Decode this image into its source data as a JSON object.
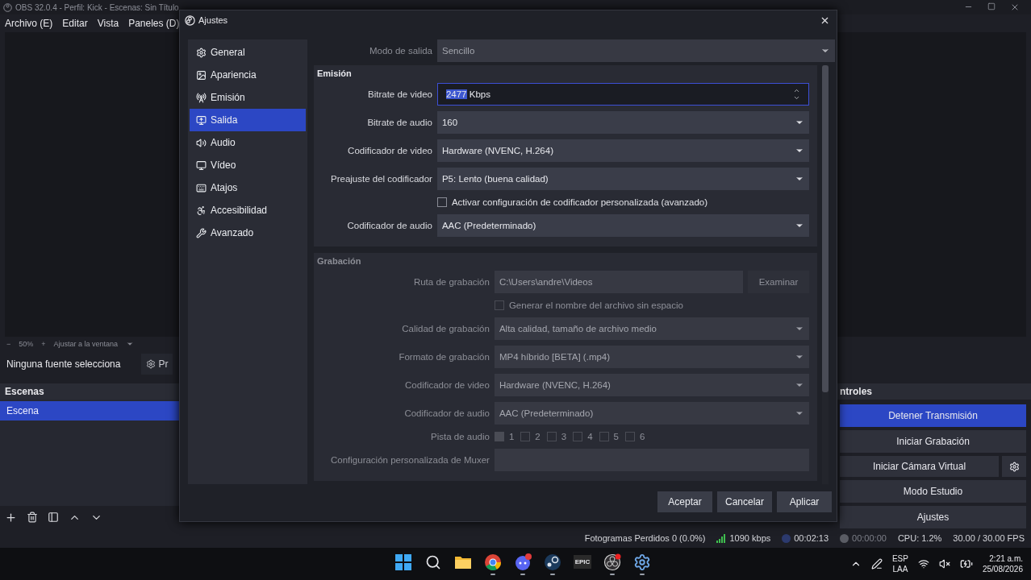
{
  "main_window": {
    "title": "OBS 32.0.4 - Perfil: Kick - Escenas: Sin Título",
    "menu": [
      "Archivo (E)",
      "Editar",
      "Vista",
      "Paneles (D)"
    ]
  },
  "zoom_bar": {
    "minus": "−",
    "zoom": "50%",
    "plus": "+",
    "fit": "Ajustar a la ventana"
  },
  "source_bar": {
    "label": "Ninguna fuente selecciona",
    "button": "Pr"
  },
  "scenes_dock": {
    "title": "Escenas",
    "scenes": [
      {
        "name": "Escena",
        "selected": true
      }
    ]
  },
  "controls_dock": {
    "title": "ntroles",
    "buttons": [
      {
        "label": "Detener Transmisión",
        "on": true,
        "kind": "plain"
      },
      {
        "label": "Iniciar Grabación",
        "on": false,
        "kind": "plain"
      },
      {
        "label": "Iniciar Cámara Virtual",
        "on": false,
        "kind": "split"
      },
      {
        "label": "Modo Estudio",
        "on": false,
        "kind": "plain"
      },
      {
        "label": "Ajustes",
        "on": false,
        "kind": "plain"
      }
    ]
  },
  "status_bar": {
    "dropped": "Fotogramas Perdidos 0 (0.0%)",
    "bitrate": "1090 kbps",
    "stream_time": "00:02:13",
    "streaming": true,
    "record_time": "00:00:00",
    "recording": false,
    "cpu": "CPU: 1.2%",
    "fps": "30.00 / 30.00 FPS"
  },
  "dialog": {
    "title": "Ajustes",
    "sidebar": [
      {
        "label": "General",
        "kind": "gear",
        "selected": false
      },
      {
        "label": "Apariencia",
        "kind": "image",
        "selected": false
      },
      {
        "label": "Emisión",
        "kind": "antenna",
        "selected": false
      },
      {
        "label": "Salida",
        "kind": "output",
        "selected": true
      },
      {
        "label": "Audio",
        "kind": "speaker",
        "selected": false
      },
      {
        "label": "Vídeo",
        "kind": "monitor",
        "selected": false
      },
      {
        "label": "Atajos",
        "kind": "keyboard",
        "selected": false
      },
      {
        "label": "Accesibilidad",
        "kind": "figure",
        "selected": false
      },
      {
        "label": "Avanzado",
        "kind": "tools",
        "selected": false
      }
    ],
    "output_mode": {
      "label": "Modo de salida",
      "value": "Sencillo"
    },
    "groups": [
      {
        "title": "Emisión",
        "disabled": false,
        "rows": [
          {
            "kind": "spin",
            "label": "Bitrate de video",
            "value": "2477",
            "unit": "Kbps",
            "focused": true
          },
          {
            "kind": "select",
            "label": "Bitrate de audio",
            "value": "160"
          },
          {
            "kind": "select",
            "label": "Codificador de video",
            "value": "Hardware (NVENC, H.264)"
          },
          {
            "kind": "select",
            "label": "Preajuste del codificador",
            "value": "P5: Lento (buena calidad)"
          },
          {
            "kind": "checkbox",
            "label": "Activar configuración de codificador personalizada (avanzado)",
            "checked": false
          },
          {
            "kind": "select",
            "label": "Codificador de audio",
            "value": "AAC (Predeterminado)"
          }
        ]
      },
      {
        "title": "Grabación",
        "disabled": true,
        "rows": [
          {
            "kind": "path",
            "label": "Ruta de grabación",
            "value": "C:\\Users\\andre\\Videos",
            "button": "Examinar"
          },
          {
            "kind": "checkbox",
            "label": "Generar el nombre del archivo sin espacio",
            "checked": false
          },
          {
            "kind": "select",
            "label": "Calidad de grabación",
            "value": "Alta calidad, tamaño de archivo medio"
          },
          {
            "kind": "select",
            "label": "Formato de grabación",
            "value": "MP4 híbrido [BETA] (.mp4)"
          },
          {
            "kind": "select",
            "label": "Codificador de video",
            "value": "Hardware (NVENC, H.264)"
          },
          {
            "kind": "select",
            "label": "Codificador de audio",
            "value": "AAC (Predeterminado)"
          },
          {
            "kind": "tracks",
            "label": "Pista de audio",
            "tracks": [
              {
                "label": "1",
                "checked": true
              },
              {
                "label": "2",
                "checked": false
              },
              {
                "label": "3",
                "checked": false
              },
              {
                "label": "4",
                "checked": false
              },
              {
                "label": "5",
                "checked": false
              },
              {
                "label": "6",
                "checked": false
              }
            ]
          },
          {
            "kind": "text",
            "label": "Configuración personalizada de Muxer"
          }
        ]
      }
    ],
    "buttons": [
      "Aceptar",
      "Cancelar",
      "Aplicar"
    ]
  },
  "taskbar": {
    "apps": [
      {
        "kind": "windows",
        "running": false
      },
      {
        "kind": "search",
        "running": false
      },
      {
        "kind": "folder",
        "running": false
      },
      {
        "kind": "chrome",
        "running": true
      },
      {
        "kind": "discord",
        "running": true
      },
      {
        "kind": "steam",
        "running": true
      },
      {
        "kind": "epic",
        "label": "EPIC",
        "running": false
      },
      {
        "kind": "obs",
        "running": true
      },
      {
        "kind": "gear",
        "running": true
      }
    ],
    "language": "ESP",
    "layout": "LAA",
    "time": "2:21 a.m.",
    "date": "25/08/2026"
  }
}
